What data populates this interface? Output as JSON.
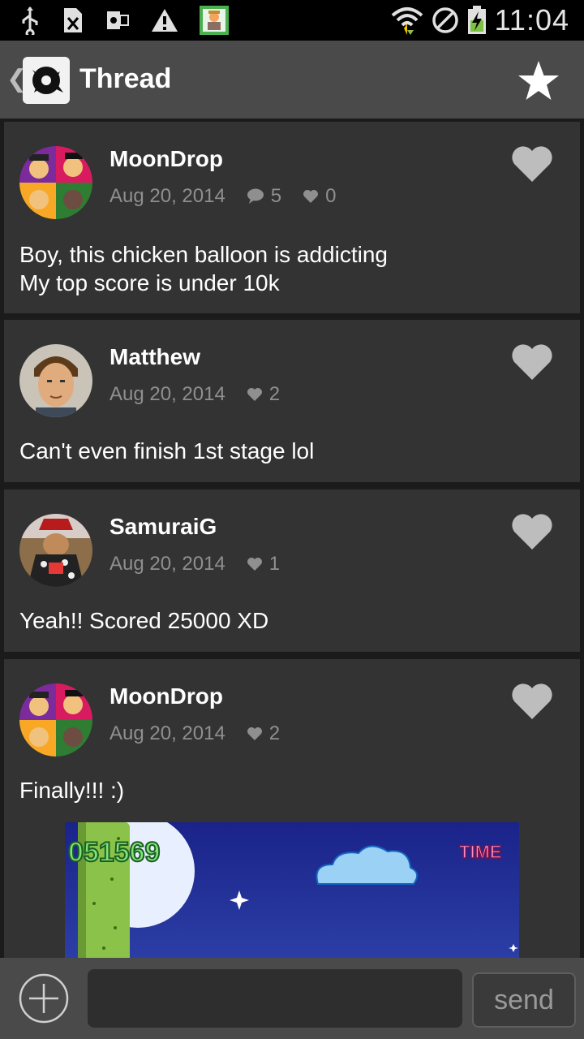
{
  "status_bar": {
    "time": "11:04",
    "icons": [
      "usb-icon",
      "sim-icon",
      "outlook-icon",
      "warning-icon",
      "app-notification-icon",
      "wifi-icon",
      "blocked-icon",
      "battery-charging-icon"
    ]
  },
  "action_bar": {
    "title": "Thread",
    "back_icon": "chevron-left-icon",
    "logo_icon": "app-logo-icon",
    "star_icon": "star-icon"
  },
  "colors": {
    "background": "#1b1b1b",
    "card": "#333333",
    "action_bar": "#4a4a4a",
    "meta_text": "#8f8f8f",
    "heart": "#bdbdbd"
  },
  "posts": [
    {
      "author": "MoonDrop",
      "date": "Aug 20, 2014",
      "comments": "5",
      "likes": "0",
      "text_lines": [
        "Boy, this chicken balloon is addicting",
        "My top score is under 10k"
      ]
    },
    {
      "author": "Matthew",
      "date": "Aug 20, 2014",
      "likes": "2",
      "text_lines": [
        "Can't even finish 1st stage lol"
      ]
    },
    {
      "author": "SamuraiG",
      "date": "Aug 20, 2014",
      "likes": "1",
      "text_lines": [
        "Yeah!! Scored 25000 XD"
      ]
    },
    {
      "author": "MoonDrop",
      "date": "Aug 20, 2014",
      "likes": "2",
      "text_lines": [
        "Finally!!! :)"
      ],
      "image": {
        "score": "051569",
        "time_label": "TIME"
      }
    }
  ],
  "composer": {
    "placeholder": "",
    "send_label": "send",
    "add_icon": "plus-circle-icon"
  }
}
